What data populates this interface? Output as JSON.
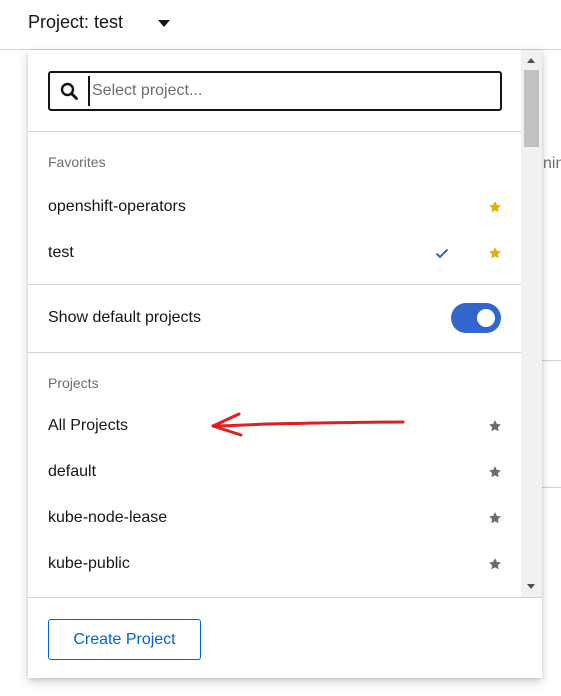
{
  "header": {
    "project_label": "Project: test"
  },
  "background": {
    "fragment_text": "nin"
  },
  "search": {
    "placeholder": "Select project..."
  },
  "favorites": {
    "title": "Favorites",
    "items": [
      {
        "label": "openshift-operators",
        "selected": false,
        "favorited": true
      },
      {
        "label": "test",
        "selected": true,
        "favorited": true
      }
    ]
  },
  "toggle": {
    "label": "Show default projects",
    "on": true
  },
  "projects": {
    "title": "Projects",
    "items": [
      {
        "label": "All Projects",
        "favorited": false
      },
      {
        "label": "default",
        "favorited": false
      },
      {
        "label": "kube-node-lease",
        "favorited": false
      },
      {
        "label": "kube-public",
        "favorited": false
      }
    ]
  },
  "footer": {
    "create_label": "Create Project"
  },
  "colors": {
    "accent": "#3366cc",
    "link": "#0066cc",
    "favorite_star": "#e2b100",
    "unfavorite_star": "#6a6e73",
    "annotation": "#e02020"
  }
}
